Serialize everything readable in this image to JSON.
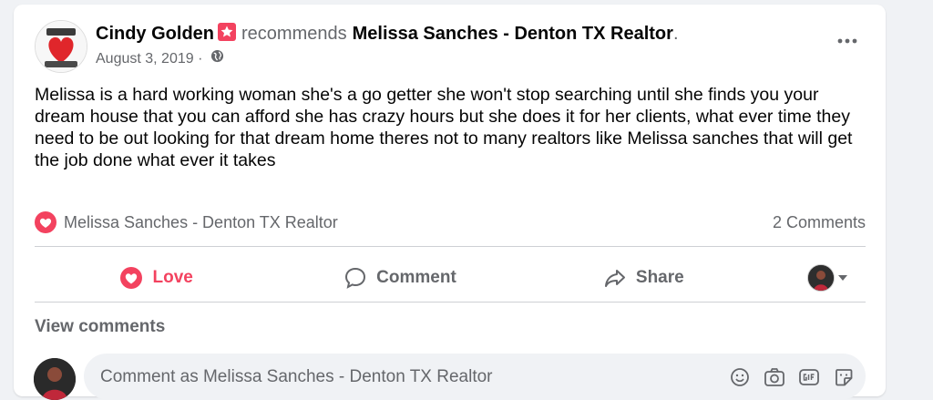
{
  "post": {
    "author": "Cindy Golden",
    "verb": "recommends",
    "page_name": "Melissa Sanches - Denton TX Realtor",
    "period": ".",
    "date": "August 3, 2019",
    "date_sep": " · ",
    "text": "Melissa is  a hard working woman she's a go getter  she won't stop searching until she finds you your dream house that you can afford she has crazy hours but she does it for her clients, what ever time they need to be out looking for that dream home theres not to many realtors like Melissa sanches that will get the job done what ever it takes"
  },
  "reactions": {
    "reactor": "Melissa Sanches - Denton TX Realtor",
    "comments_count": "2 Comments"
  },
  "actions": {
    "love": "Love",
    "comment": "Comment",
    "share": "Share"
  },
  "comments": {
    "view_label": "View comments",
    "composer_placeholder": "Comment as Melissa Sanches - Denton TX Realtor"
  },
  "colors": {
    "love": "#f3425f",
    "secondary_text": "#65676b",
    "background": "#f0f2f5"
  },
  "icons": [
    "recommend-icon",
    "globe-icon",
    "more-icon",
    "love-icon",
    "comment-icon",
    "share-icon",
    "chevron-down-icon",
    "emoji-icon",
    "camera-icon",
    "gif-icon",
    "sticker-icon"
  ]
}
